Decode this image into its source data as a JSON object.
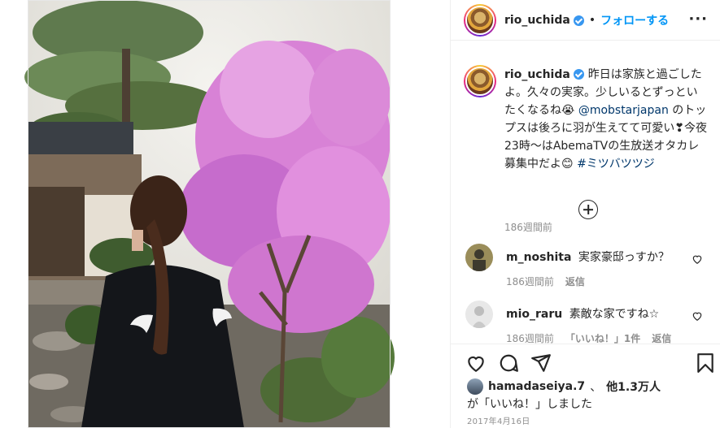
{
  "post": {
    "username": "rio_uchida",
    "follow_label": "フォローする",
    "dot": "•",
    "more_label": "···"
  },
  "caption": {
    "username": "rio_uchida",
    "text_1": "昨日は家族と過ごしたよ。久々の実家。少しいるとずっといたくなるね",
    "emoji_1": "😭",
    "mention": "@mobstarjapan",
    "text_2": "のトップスは後ろに羽が生えてて可愛い❣今夜23時〜はAbemaTVの生放送オタカレ募集中だよ",
    "emoji_2": "😊",
    "hashtag": "#ミツバツツジ",
    "time": "186週間前"
  },
  "comments": [
    {
      "username": "m_noshita",
      "text": "実家豪邸っすか？",
      "time": "186週間前",
      "reply": "返信",
      "likes": ""
    },
    {
      "username": "mio_raru",
      "text": "素敵な家ですね☆",
      "time": "186週間前",
      "likes": "「いいね！」1件",
      "reply": "返信"
    }
  ],
  "likes": {
    "first_user": "hamadaseiya.7",
    "separator": "、",
    "others": "他1.3万人",
    "suffix": "が「いいね！」しました"
  },
  "date": "2017年4月16日",
  "icons": [
    "heart-icon",
    "comment-icon",
    "share-icon",
    "bookmark-icon",
    "add-comment-icon",
    "verified-icon",
    "more-icon"
  ],
  "colors": {
    "link": "#0095f6",
    "mention": "#00376b",
    "muted": "#8e8e8e",
    "verified": "#3897f0"
  }
}
